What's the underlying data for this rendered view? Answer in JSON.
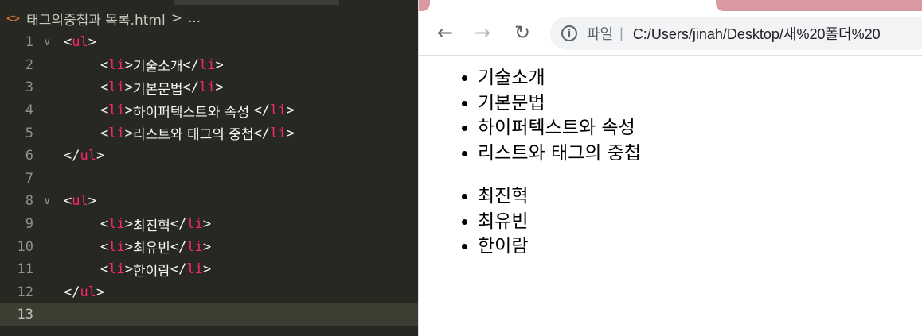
{
  "editor": {
    "breadcrumb": {
      "icon": "<>",
      "file": "태그의중첩과 목록.html",
      "separator": ">",
      "more": "..."
    },
    "lines": [
      {
        "num": "1",
        "fold": true,
        "kind": "open",
        "tag": "ul"
      },
      {
        "num": "2",
        "kind": "item",
        "tag": "li",
        "text": "기술소개"
      },
      {
        "num": "3",
        "kind": "item",
        "tag": "li",
        "text": "기본문법"
      },
      {
        "num": "4",
        "kind": "item",
        "tag": "li",
        "text": "하이퍼텍스트와 속성 "
      },
      {
        "num": "5",
        "kind": "item",
        "tag": "li",
        "text": "리스트와 태그의 중첩"
      },
      {
        "num": "6",
        "kind": "close",
        "tag": "ul"
      },
      {
        "num": "7",
        "kind": "blank"
      },
      {
        "num": "8",
        "fold": true,
        "kind": "open",
        "tag": "ul"
      },
      {
        "num": "9",
        "kind": "item",
        "tag": "li",
        "text": "최진혁"
      },
      {
        "num": "10",
        "kind": "item",
        "tag": "li",
        "text": "최유빈"
      },
      {
        "num": "11",
        "kind": "item",
        "tag": "li",
        "text": "한이람"
      },
      {
        "num": "12",
        "kind": "close",
        "tag": "ul"
      },
      {
        "num": "13",
        "kind": "blank",
        "current": true
      }
    ]
  },
  "browser": {
    "nav": {
      "back_icon": "←",
      "forward_icon": "→",
      "reload_icon": "↻"
    },
    "omnibox": {
      "info_icon": "i",
      "label": "파일",
      "separator": "|",
      "url": "C:/Users/jinah/Desktop/새%20폴더%20"
    },
    "lists": [
      {
        "items": [
          "기술소개",
          "기본문법",
          "하이퍼텍스트와 속성",
          "리스트와 태그의 중첩"
        ]
      },
      {
        "items": [
          "최진혁",
          "최유빈",
          "한이람"
        ]
      }
    ]
  }
}
